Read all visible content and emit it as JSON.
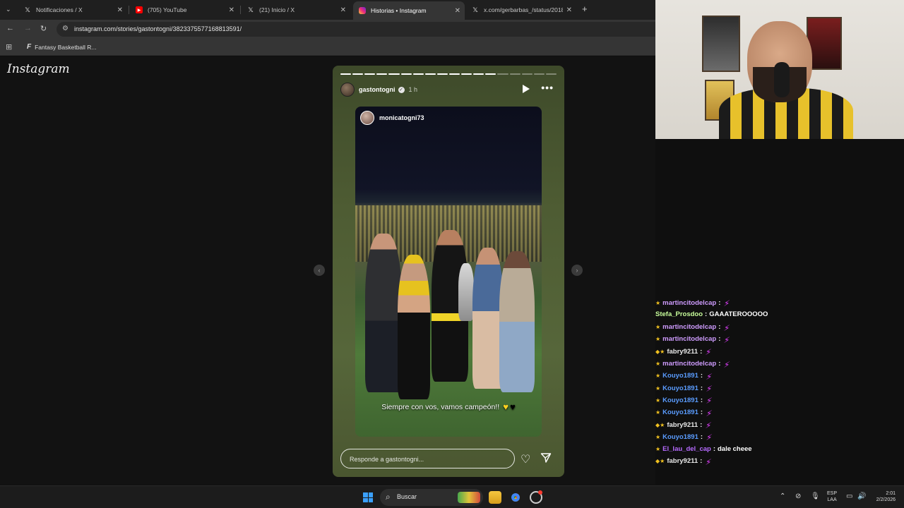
{
  "browser": {
    "tabs": [
      {
        "title": "Notificaciones / X",
        "icon": "x-logo-icon",
        "active": false
      },
      {
        "title": "(705) YouTube",
        "icon": "youtube-icon",
        "active": false
      },
      {
        "title": "(21) Inicio / X",
        "icon": "x-logo-icon",
        "active": false
      },
      {
        "title": "Historias • Instagram",
        "icon": "instagram-icon",
        "active": true
      },
      {
        "title": "x.com/gerbarbas_/status/2018",
        "icon": "x-logo-icon",
        "active": false
      }
    ],
    "url": "instagram.com/stories/gastontogni/3823375577168813591/",
    "bookmark": "Fantasy Basketball R..."
  },
  "instagram": {
    "logo": "Instagram",
    "story": {
      "segments_total": 18,
      "segments_done": 13,
      "username": "gastontogni",
      "time": "1 h",
      "repost_user": "monicatogni73",
      "caption": "Siempre con vos, vamos campeón!!",
      "reply_placeholder": "Responde a gastontogni..."
    }
  },
  "chat": {
    "messages": [
      {
        "user": "martincitodelcap",
        "text": "",
        "color": "#cf9cff",
        "badge": "star"
      },
      {
        "user": "Stefa_Prosdoo",
        "text": "GAAATEROOOOO",
        "color": "#c9ff9c",
        "badge": ""
      },
      {
        "user": "martincitodelcap",
        "text": "",
        "color": "#cf9cff",
        "badge": "star"
      },
      {
        "user": "martincitodelcap",
        "text": "",
        "color": "#cf9cff",
        "badge": "star"
      },
      {
        "user": "fabry9211",
        "text": "",
        "color": "#e8e8e8",
        "badge": "gem-star"
      },
      {
        "user": "martincitodelcap",
        "text": "",
        "color": "#cf9cff",
        "badge": "star"
      },
      {
        "user": "Kouyo1891",
        "text": "",
        "color": "#5a9cff",
        "badge": "star"
      },
      {
        "user": "Kouyo1891",
        "text": "",
        "color": "#5a9cff",
        "badge": "star"
      },
      {
        "user": "Kouyo1891",
        "text": "",
        "color": "#5a9cff",
        "badge": "star"
      },
      {
        "user": "Kouyo1891",
        "text": "",
        "color": "#5a9cff",
        "badge": "star"
      },
      {
        "user": "fabry9211",
        "text": "",
        "color": "#e8e8e8",
        "badge": "gem-star"
      },
      {
        "user": "Kouyo1891",
        "text": "",
        "color": "#5a9cff",
        "badge": "star"
      },
      {
        "user": "El_lau_del_cap",
        "text": "dale cheee",
        "color": "#b66bff",
        "badge": "star"
      },
      {
        "user": "fabry9211",
        "text": "",
        "color": "#e8e8e8",
        "badge": "gem-star"
      }
    ]
  },
  "taskbar": {
    "search_label": "Buscar",
    "lang_line1": "ESP",
    "lang_line2": "LAA",
    "time": "2:01",
    "date": "2/2/2026"
  }
}
